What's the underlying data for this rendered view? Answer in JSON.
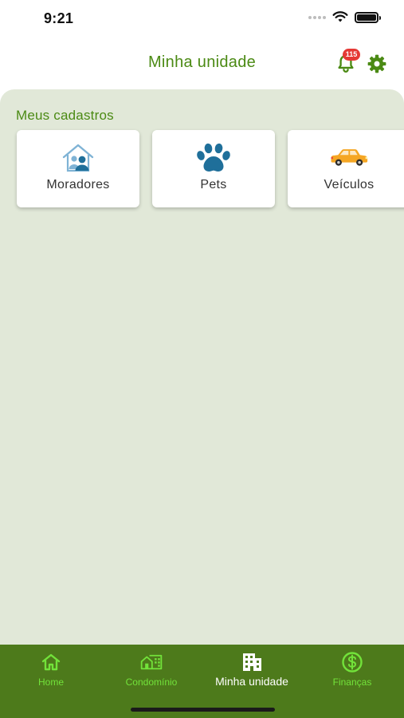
{
  "status_bar": {
    "time": "9:21"
  },
  "header": {
    "title": "Minha unidade",
    "notification_count": "115",
    "bell_icon": "bell-icon",
    "settings_icon": "gear-icon"
  },
  "main": {
    "section_title": "Meus cadastros",
    "cards": [
      {
        "label": "Moradores",
        "icon": "residents-house-icon"
      },
      {
        "label": "Pets",
        "icon": "paw-icon"
      },
      {
        "label": "Veículos",
        "icon": "car-icon"
      }
    ]
  },
  "bottom_nav": {
    "items": [
      {
        "label": "Home",
        "icon": "home-icon",
        "active": false
      },
      {
        "label": "Condomínio",
        "icon": "condo-building-icon",
        "active": false
      },
      {
        "label": "Minha unidade",
        "icon": "apartment-icon",
        "active": true
      },
      {
        "label": "Finanças",
        "icon": "dollar-circle-icon",
        "active": false
      }
    ]
  },
  "colors": {
    "brand_green": "#4b8a14",
    "nav_background": "#4d7a1b",
    "nav_inactive": "#72e23a",
    "panel_background": "#e1e8d8",
    "badge_red": "#e53935",
    "icon_blue": "#1f6f9a",
    "car_orange": "#f5a623"
  }
}
